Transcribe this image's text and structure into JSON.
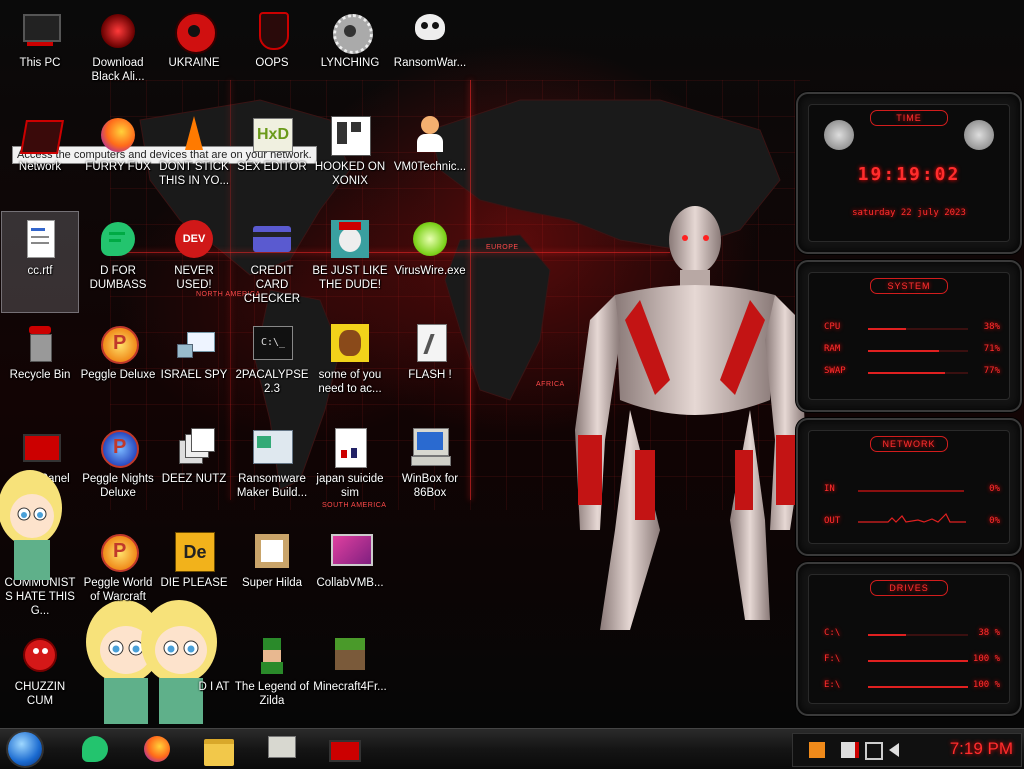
{
  "desktop": {
    "tooltip": "Access the computers and devices that are on your network.",
    "icons": [
      {
        "label": "This PC"
      },
      {
        "label": "Download Black Ali..."
      },
      {
        "label": "UKRAINE"
      },
      {
        "label": "OOPS"
      },
      {
        "label": "LYNCHING"
      },
      {
        "label": "RansomWar..."
      },
      {
        "label": "Network"
      },
      {
        "label": "FURRY FUX"
      },
      {
        "label": "DONT STICK THIS IN YO..."
      },
      {
        "label": "SEX EDITOR"
      },
      {
        "label": "HOOKED ON XONIX"
      },
      {
        "label": "VM0Technic..."
      },
      {
        "label": "cc.rtf"
      },
      {
        "label": "D FOR DUMBASS"
      },
      {
        "label": "NEVER USED!"
      },
      {
        "label": "CREDIT CARD CHECKER"
      },
      {
        "label": "BE JUST LIKE THE DUDE!"
      },
      {
        "label": "VirusWire.exe"
      },
      {
        "label": "Recycle Bin"
      },
      {
        "label": "Peggle Deluxe"
      },
      {
        "label": "ISRAEL SPY"
      },
      {
        "label": "2PACALYPSE 2.3"
      },
      {
        "label": "some of you need to ac..."
      },
      {
        "label": "FLASH !"
      },
      {
        "label": "Panel"
      },
      {
        "label": "Peggle Nights Deluxe"
      },
      {
        "label": "DEEZ NUTZ"
      },
      {
        "label": "Ransomware Maker Build..."
      },
      {
        "label": "japan suicide sim"
      },
      {
        "label": "WinBox for 86Box"
      },
      {
        "label": "COMMUNISTS HATE THIS G..."
      },
      {
        "label": "Peggle World of Warcraft"
      },
      {
        "label": "DIE PLEASE"
      },
      {
        "label": "Super Hilda"
      },
      {
        "label": "CollabVMB..."
      },
      {
        "label": "CHUZZIN CUM"
      },
      {
        "label": "D I AT"
      },
      {
        "label": "The Legend of Zilda"
      },
      {
        "label": "Minecraft4Fr..."
      }
    ],
    "map_labels": {
      "north_america": "NORTH AMERICA",
      "south_america": "SOUTH AMERICA",
      "europe": "EUROPE",
      "africa": "AFRICA"
    }
  },
  "gadget": {
    "time": {
      "title": "TIME",
      "clock": "19:19:02",
      "date": "saturday 22 july 2023"
    },
    "system": {
      "title": "SYSTEM",
      "rows": [
        {
          "label": "CPU",
          "value": "38%",
          "level": 0.38
        },
        {
          "label": "RAM",
          "value": "71%",
          "level": 0.71
        },
        {
          "label": "SWAP",
          "value": "77%",
          "level": 0.77
        }
      ]
    },
    "network": {
      "title": "NETWORK",
      "rows": [
        {
          "label": "IN",
          "value": "0%"
        },
        {
          "label": "OUT",
          "value": "0%"
        }
      ]
    },
    "drives": {
      "title": "DRIVES",
      "rows": [
        {
          "label": "C:\\",
          "value": "38 %",
          "level": 0.38
        },
        {
          "label": "F:\\",
          "value": "100 %",
          "level": 1.0
        },
        {
          "label": "E:\\",
          "value": "100 %",
          "level": 1.0
        }
      ]
    }
  },
  "taskbar": {
    "clock": "7:19 PM",
    "pinned": [
      "start-orb",
      "chat-app",
      "firefox",
      "file-explorer",
      "winbox",
      "red-app"
    ]
  },
  "colors": {
    "accent": "#ff2d2d",
    "taskbar": "#151515"
  }
}
